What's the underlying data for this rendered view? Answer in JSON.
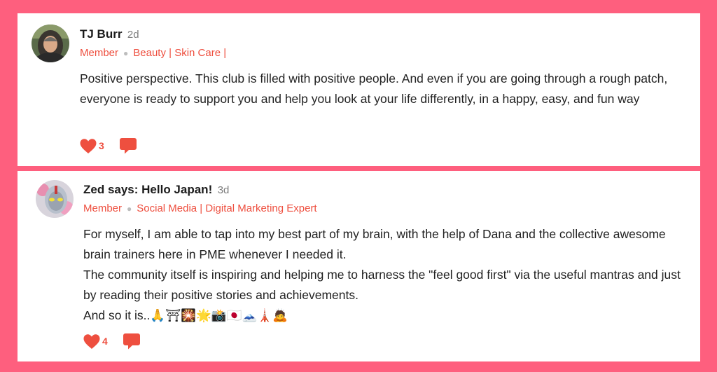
{
  "colors": {
    "background": "#FE5F7E",
    "accent": "#EE4F3F",
    "card": "#FFFFFF"
  },
  "posts": [
    {
      "author": "TJ Burr",
      "time": "2d",
      "role": "Member",
      "tags": "Beauty | Skin Care |",
      "text": "Positive perspective. This club is filled with positive people. And even if you are going through a rough patch, everyone is ready to support you and help you look at your life differently, in a happy, easy, and fun way",
      "likes": "3",
      "icons": {
        "like": "heart-icon",
        "comment": "comment-bubble-icon"
      }
    },
    {
      "author": "Zed says: Hello Japan!",
      "time": "3d",
      "role": "Member",
      "tags": "Social Media | Digital Marketing Expert",
      "lines": [
        "For myself, I am able to tap into my best part of my brain, with the help of Dana and the collective awesome brain trainers here in PME whenever I needed it.",
        "The community itself is inspiring and helping me to harness the \"feel good first\" via the useful mantras and just by reading their positive stories and achievements.",
        "And so it is..🙏⛩🎇🌟📸🇯🇵🗻🗼🙇"
      ],
      "likes": "4",
      "icons": {
        "like": "heart-icon",
        "comment": "comment-bubble-icon"
      }
    }
  ]
}
